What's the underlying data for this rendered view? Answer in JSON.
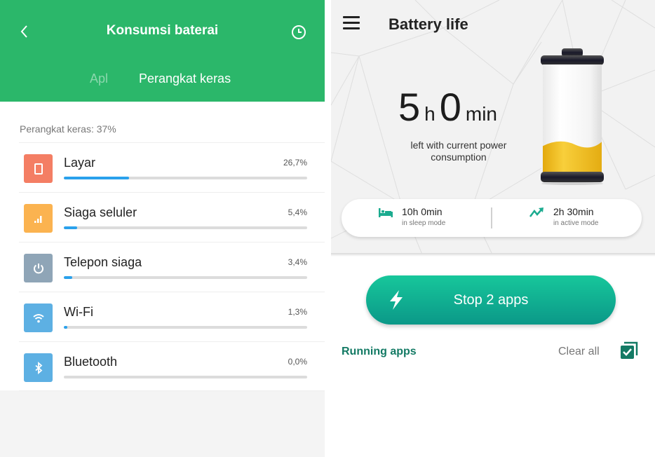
{
  "left": {
    "header": {
      "title": "Konsumsi baterai",
      "back_icon": "chevron-left-icon",
      "history_icon": "clock-icon"
    },
    "tabs": [
      {
        "label": "Apl",
        "active": false
      },
      {
        "label": "Perangkat keras",
        "active": true
      }
    ],
    "summary": "Perangkat keras: 37%",
    "items": [
      {
        "label": "Layar",
        "percent_text": "26,7%",
        "percent": 26.7,
        "icon": "screen-icon",
        "icon_color": "#f47e64"
      },
      {
        "label": "Siaga seluler",
        "percent_text": "5,4%",
        "percent": 5.4,
        "icon": "signal-icon",
        "icon_color": "#fbb350"
      },
      {
        "label": "Telepon siaga",
        "percent_text": "3,4%",
        "percent": 3.4,
        "icon": "power-icon",
        "icon_color": "#8fa5b7"
      },
      {
        "label": "Wi-Fi",
        "percent_text": "1,3%",
        "percent": 1.3,
        "icon": "wifi-icon",
        "icon_color": "#5db0e3"
      },
      {
        "label": "Bluetooth",
        "percent_text": "0,0%",
        "percent": 0.0,
        "icon": "bluetooth-icon",
        "icon_color": "#5db0e3"
      }
    ],
    "colors": {
      "header": "#2bb76a",
      "bar_fill": "#2aa1ec",
      "bar_track": "#dcdcdc"
    }
  },
  "right": {
    "title": "Battery life",
    "menu_icon": "hamburger-menu-icon",
    "time_left": {
      "hours": "5",
      "hours_unit": "h",
      "minutes": "0",
      "minutes_unit": "min"
    },
    "time_left_caption": "left with current power consumption",
    "battery_level": 0.28,
    "modes": {
      "sleep": {
        "time": "10h  0min",
        "label": "in sleep mode",
        "icon": "bed-icon"
      },
      "active": {
        "time": "2h  30min",
        "label": "in active mode",
        "icon": "trending-up-icon"
      }
    },
    "stop_button": {
      "label": "Stop 2 apps",
      "icon": "lightning-bolt-icon"
    },
    "running_apps_label": "Running apps",
    "clear_all_label": "Clear all",
    "select_all_icon": "multi-checkbox-icon",
    "colors": {
      "accent": "#137a64",
      "button_top": "#17c79b",
      "button_bottom": "#0b9888",
      "battery_fill": "#f5bf1e"
    }
  }
}
